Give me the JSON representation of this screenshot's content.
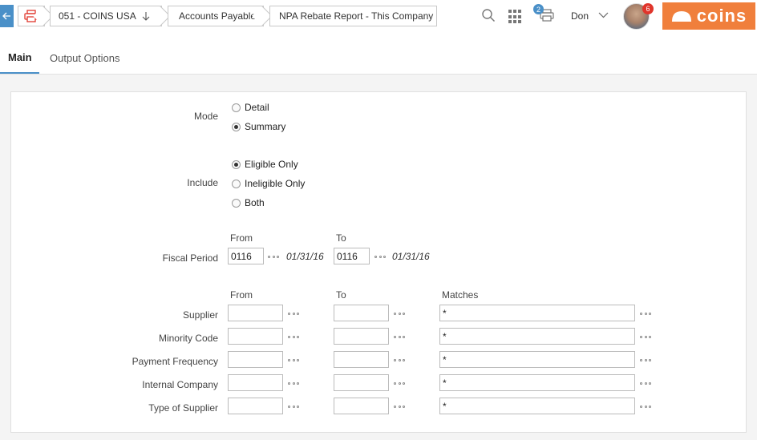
{
  "header": {
    "company": "051 - COINS USA",
    "module": "Accounts Payable",
    "report": "NPA Rebate Report - This Company",
    "queue_count": "2",
    "user_name": "Don",
    "notification_count": "6",
    "logo_text": "coins",
    "accent_color": "#4a90c8",
    "brand_color": "#f07f3c"
  },
  "tabs": [
    {
      "label": "Main",
      "active": true
    },
    {
      "label": "Output Options",
      "active": false
    }
  ],
  "form": {
    "mode": {
      "label": "Mode",
      "options": [
        {
          "label": "Detail",
          "checked": false
        },
        {
          "label": "Summary",
          "checked": true
        }
      ]
    },
    "include": {
      "label": "Include",
      "options": [
        {
          "label": "Eligible Only",
          "checked": true
        },
        {
          "label": "Ineligible Only",
          "checked": false
        },
        {
          "label": "Both",
          "checked": false
        }
      ]
    },
    "fiscal": {
      "label": "Fiscal Period",
      "from_head": "From",
      "to_head": "To",
      "from_value": "0116",
      "from_date": "01/31/16",
      "to_value": "0116",
      "to_date": "01/31/16"
    },
    "ranges": {
      "from_head": "From",
      "to_head": "To",
      "matches_head": "Matches",
      "rows": [
        {
          "label": "Supplier",
          "from": "",
          "to": "",
          "matches": "*"
        },
        {
          "label": "Minority Code",
          "from": "",
          "to": "",
          "matches": "*"
        },
        {
          "label": "Payment Frequency",
          "from": "",
          "to": "",
          "matches": "*"
        },
        {
          "label": "Internal Company",
          "from": "",
          "to": "",
          "matches": "*"
        },
        {
          "label": "Type of Supplier",
          "from": "",
          "to": "",
          "matches": "*"
        }
      ]
    }
  }
}
